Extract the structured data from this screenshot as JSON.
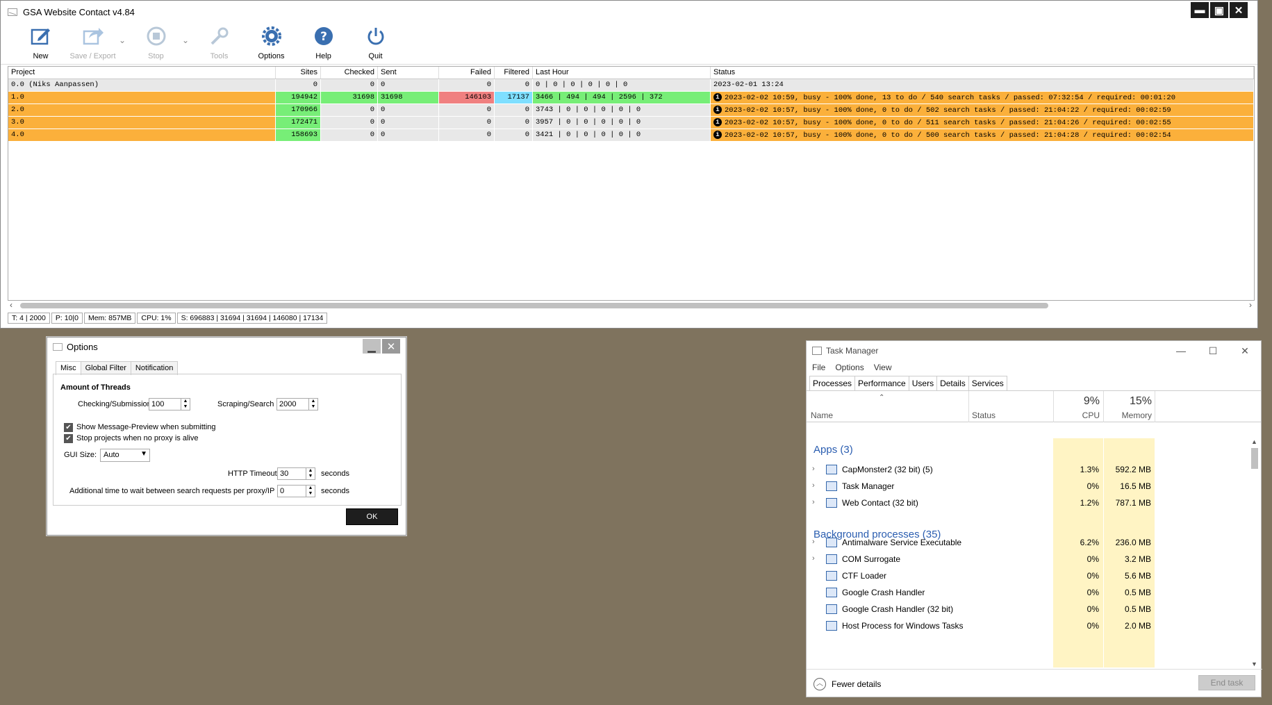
{
  "gsa": {
    "title": "GSA Website Contact v4.84",
    "winbtns": [
      "▬",
      "▣",
      "✕"
    ],
    "toolbar": [
      {
        "label": "New",
        "icon": "new-icon",
        "enabled": true
      },
      {
        "label": "Save / Export",
        "icon": "save-export-icon",
        "enabled": false
      },
      {
        "label": "Stop",
        "icon": "stop-icon",
        "enabled": false
      },
      {
        "label": "Tools",
        "icon": "tools-icon",
        "enabled": false
      },
      {
        "label": "Options",
        "icon": "gear-icon",
        "enabled": true
      },
      {
        "label": "Help",
        "icon": "help-icon",
        "enabled": true
      },
      {
        "label": "Quit",
        "icon": "power-icon",
        "enabled": true
      }
    ],
    "columns": [
      "Project",
      "Sites",
      "Checked",
      "Sent",
      "Failed",
      "Filtered",
      "Last Hour",
      "Status"
    ],
    "rows": [
      {
        "project": "0.0 (Niks Aanpassen)",
        "sites": "0",
        "checked": "0",
        "sent": "0",
        "failed": "0",
        "filtered": "0",
        "last": "0 | 0 | 0 | 0 | 0 | 0",
        "status": "2023-02-01 13:24",
        "info": false
      },
      {
        "project": "1.0",
        "sites": "194942",
        "checked": "31698",
        "sent": "31698",
        "failed": "146103",
        "filtered": "17137",
        "last": "3466 | 494 | 494 | 2596 | 372",
        "status": "2023-02-02 10:59, busy - 100% done, 13 to do / 540 search tasks / passed: 07:32:54 / required: 00:01:20",
        "info": true
      },
      {
        "project": "2.0",
        "sites": "170966",
        "checked": "0",
        "sent": "0",
        "failed": "0",
        "filtered": "0",
        "last": "3743 | 0 | 0 | 0 | 0 | 0",
        "status": "2023-02-02 10:57, busy - 100% done, 0 to do / 502 search tasks / passed: 21:04:22 / required: 00:02:59",
        "info": true
      },
      {
        "project": "3.0",
        "sites": "172471",
        "checked": "0",
        "sent": "0",
        "failed": "0",
        "filtered": "0",
        "last": "3957 | 0 | 0 | 0 | 0 | 0",
        "status": "2023-02-02 10:57, busy - 100% done, 0 to do / 511 search tasks / passed: 21:04:26 / required: 00:02:55",
        "info": true
      },
      {
        "project": "4.0",
        "sites": "158693",
        "checked": "0",
        "sent": "0",
        "failed": "0",
        "filtered": "0",
        "last": "3421 | 0 | 0 | 0 | 0 | 0",
        "status": "2023-02-02 10:57, busy - 100% done, 0 to do / 500 search tasks / passed: 21:04:28 / required: 00:02:54",
        "info": true
      }
    ],
    "statusbar": [
      "T: 4 | 2000",
      "P: 10|0",
      "Mem: 857MB",
      "CPU: 1%",
      "S: 696883 | 31694 | 31694 | 146080 | 17134"
    ]
  },
  "options": {
    "title": "Options",
    "tabs": [
      "Misc",
      "Global Filter",
      "Notification"
    ],
    "section": "Amount of Threads",
    "checking_label": "Checking/Submission",
    "checking_value": "100",
    "scraping_label": "Scraping/Search",
    "scraping_value": "2000",
    "cb1": "Show Message-Preview when submitting",
    "cb2": "Stop projects when no proxy is alive",
    "gui_label": "GUI Size:",
    "gui_value": "Auto",
    "http_label": "HTTP Timeout",
    "http_value": "30",
    "seconds": "seconds",
    "wait_label": "Additional time to wait between search requests per proxy/IP",
    "wait_value": "0",
    "ok": "OK"
  },
  "taskmgr": {
    "title": "Task Manager",
    "menu": [
      "File",
      "Options",
      "View"
    ],
    "tabs": [
      "Processes",
      "Performance",
      "Users",
      "Details",
      "Services"
    ],
    "col_name": "Name",
    "col_status": "Status",
    "cpu_pct": "9%",
    "cpu_label": "CPU",
    "mem_pct": "15%",
    "mem_label": "Memory",
    "apps_header": "Apps (3)",
    "bg_header": "Background processes (35)",
    "apps": [
      {
        "name": "CapMonster2 (32 bit) (5)",
        "cpu": "1.3%",
        "mem": "592.2 MB"
      },
      {
        "name": "Task Manager",
        "cpu": "0%",
        "mem": "16.5 MB"
      },
      {
        "name": "Web Contact (32 bit)",
        "cpu": "1.2%",
        "mem": "787.1 MB"
      }
    ],
    "bg": [
      {
        "name": "Antimalware Service Executable",
        "cpu": "6.2%",
        "mem": "236.0 MB",
        "exp": true
      },
      {
        "name": "COM Surrogate",
        "cpu": "0%",
        "mem": "3.2 MB",
        "exp": true
      },
      {
        "name": "CTF Loader",
        "cpu": "0%",
        "mem": "5.6 MB",
        "exp": false
      },
      {
        "name": "Google Crash Handler",
        "cpu": "0%",
        "mem": "0.5 MB",
        "exp": false
      },
      {
        "name": "Google Crash Handler (32 bit)",
        "cpu": "0%",
        "mem": "0.5 MB",
        "exp": false
      },
      {
        "name": "Host Process for Windows Tasks",
        "cpu": "0%",
        "mem": "2.0 MB",
        "exp": false
      }
    ],
    "fewer": "Fewer details",
    "endtask": "End task"
  }
}
